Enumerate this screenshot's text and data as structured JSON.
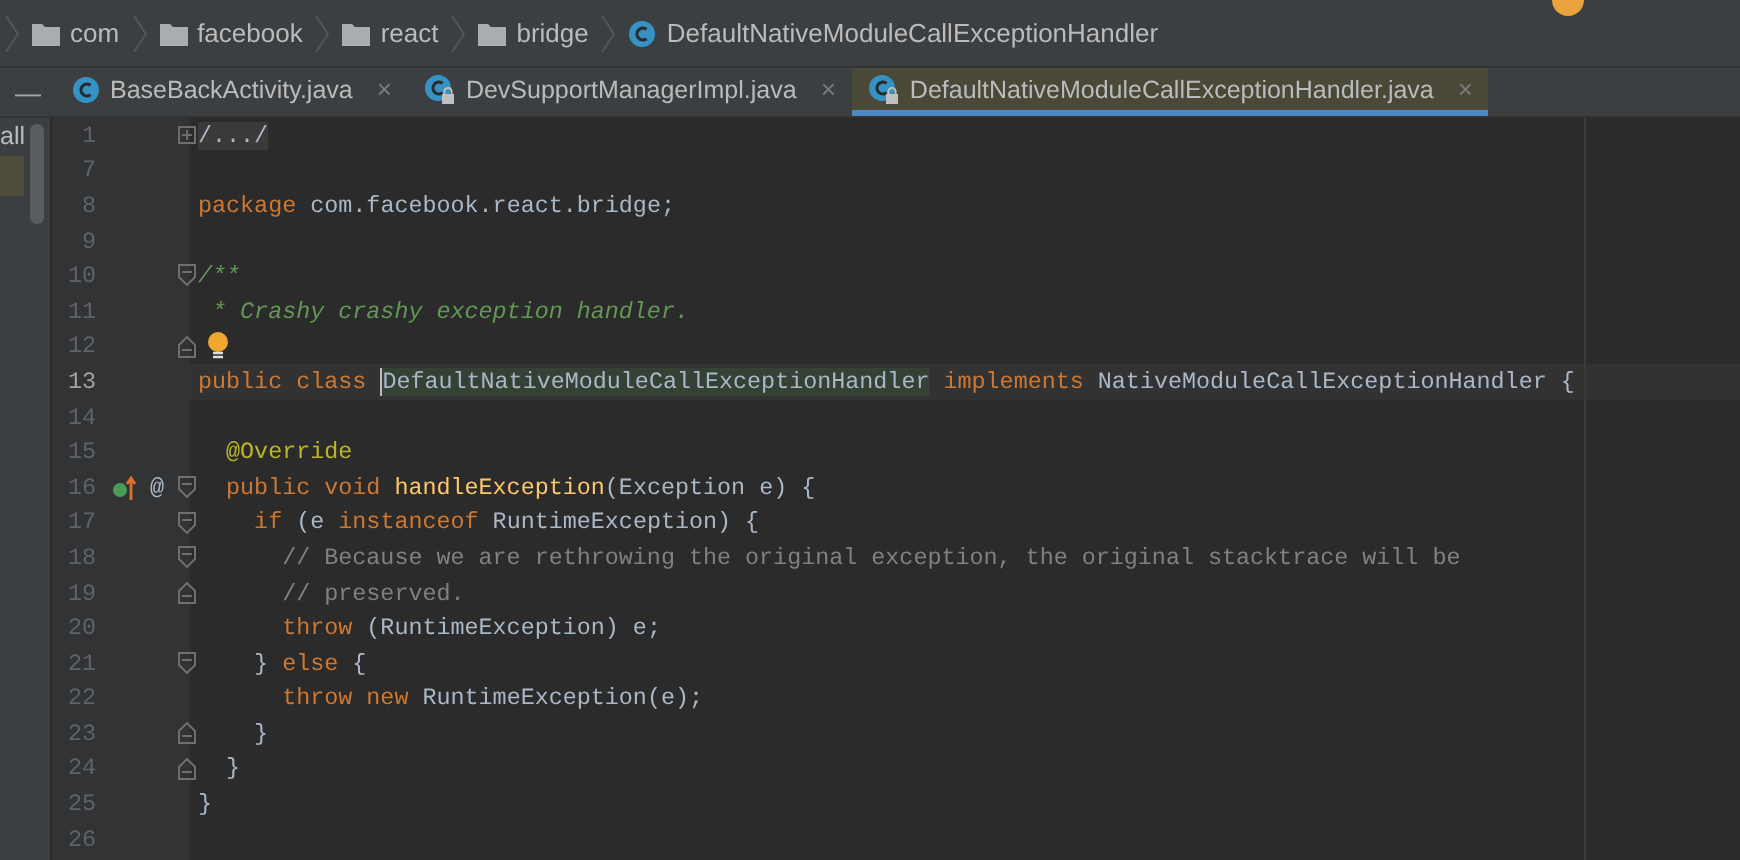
{
  "breadcrumbs": [
    {
      "kind": "folder",
      "label": "com"
    },
    {
      "kind": "folder",
      "label": "facebook"
    },
    {
      "kind": "folder",
      "label": "react"
    },
    {
      "kind": "folder",
      "label": "bridge"
    },
    {
      "kind": "class",
      "label": "DefaultNativeModuleCallExceptionHandler"
    }
  ],
  "tool_window_button": "—",
  "tabs": [
    {
      "label": "BaseBackActivity.java",
      "locked": false,
      "selected": false,
      "close": "×"
    },
    {
      "label": "DevSupportManagerImpl.java",
      "locked": true,
      "selected": false,
      "close": "×"
    },
    {
      "label": "DefaultNativeModuleCallExceptionHandler.java",
      "locked": true,
      "selected": true,
      "close": "×"
    }
  ],
  "side_panel": {
    "text": "all"
  },
  "editor": {
    "lines": [
      {
        "number": "1",
        "fold_marker": {
          "kind": "collapsed"
        },
        "tokens": [
          {
            "kind": "folded",
            "text": "/.../"
          }
        ]
      },
      {
        "number": "7"
      },
      {
        "number": "8",
        "tokens": [
          {
            "kind": "keyword",
            "text": "package"
          },
          {
            "kind": "plain",
            "text": " com.facebook.react.bridge;"
          }
        ]
      },
      {
        "number": "9"
      },
      {
        "number": "10",
        "fold_marker": {
          "kind": "start"
        },
        "tokens": [
          {
            "kind": "doc",
            "text": "/**"
          }
        ]
      },
      {
        "number": "11",
        "tokens": [
          {
            "kind": "doc",
            "text": " * Crashy crashy exception handler."
          }
        ]
      },
      {
        "number": "12",
        "fold_marker": {
          "kind": "end"
        },
        "bulb": true
      },
      {
        "number": "13",
        "current": true,
        "tokens": [
          {
            "kind": "keyword",
            "text": "public class "
          },
          {
            "kind": "highlight",
            "text": "DefaultNativeModuleCallExceptionHandler"
          },
          {
            "kind": "keyword",
            "text": " implements"
          },
          {
            "kind": "plain",
            "text": " NativeModuleCallExceptionHandler {"
          }
        ]
      },
      {
        "number": "14"
      },
      {
        "number": "15",
        "tokens": [
          {
            "kind": "annotation",
            "text": "  @Override"
          }
        ]
      },
      {
        "number": "16",
        "fold_marker": {
          "kind": "start"
        },
        "gutter": [
          {
            "kind": "override"
          },
          {
            "kind": "symbol",
            "text": "@"
          }
        ],
        "tokens": [
          {
            "kind": "keyword",
            "text": "  public void "
          },
          {
            "kind": "method",
            "text": "handleException"
          },
          {
            "kind": "plain",
            "text": "(Exception e) {"
          }
        ]
      },
      {
        "number": "17",
        "fold_marker": {
          "kind": "start"
        },
        "tokens": [
          {
            "kind": "keyword",
            "text": "    if"
          },
          {
            "kind": "plain",
            "text": " (e "
          },
          {
            "kind": "keyword",
            "text": "instanceof"
          },
          {
            "kind": "plain",
            "text": " RuntimeException) {"
          }
        ]
      },
      {
        "number": "18",
        "fold_marker": {
          "kind": "start"
        },
        "tokens": [
          {
            "kind": "comment",
            "text": "      // Because we are rethrowing the original exception, the original stacktrace will be"
          }
        ]
      },
      {
        "number": "19",
        "fold_marker": {
          "kind": "end"
        },
        "tokens": [
          {
            "kind": "comment",
            "text": "      // preserved."
          }
        ]
      },
      {
        "number": "20",
        "tokens": [
          {
            "kind": "keyword",
            "text": "      throw"
          },
          {
            "kind": "plain",
            "text": " (RuntimeException) e;"
          }
        ]
      },
      {
        "number": "21",
        "fold_marker": {
          "kind": "start"
        },
        "tokens": [
          {
            "kind": "plain",
            "text": "    } "
          },
          {
            "kind": "keyword",
            "text": "else"
          },
          {
            "kind": "plain",
            "text": " {"
          }
        ]
      },
      {
        "number": "22",
        "tokens": [
          {
            "kind": "keyword",
            "text": "      throw new"
          },
          {
            "kind": "plain",
            "text": " RuntimeException(e);"
          }
        ]
      },
      {
        "number": "23",
        "fold_marker": {
          "kind": "end"
        },
        "tokens": [
          {
            "kind": "plain",
            "text": "    }"
          }
        ]
      },
      {
        "number": "24",
        "fold_marker": {
          "kind": "end"
        },
        "tokens": [
          {
            "kind": "plain",
            "text": "  }"
          }
        ]
      },
      {
        "number": "25",
        "tokens": [
          {
            "kind": "plain",
            "text": "}"
          }
        ]
      },
      {
        "number": "26"
      }
    ]
  }
}
